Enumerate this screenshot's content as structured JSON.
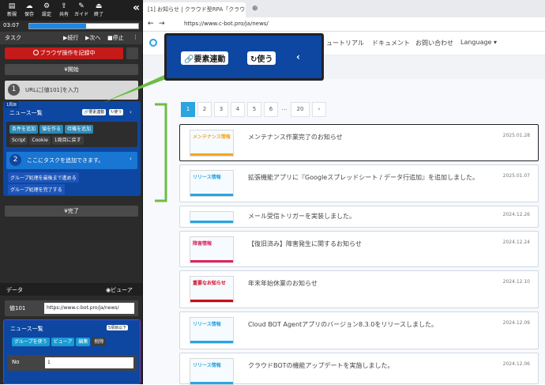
{
  "panel": {
    "toolbar": [
      {
        "label": "新規",
        "icon": "new-file-icon"
      },
      {
        "label": "保存",
        "icon": "cloud-save-icon"
      },
      {
        "label": "設定",
        "icon": "gear-icon"
      },
      {
        "label": "共有",
        "icon": "share-icon"
      },
      {
        "label": "ガイド",
        "icon": "guide-icon"
      },
      {
        "label": "終了",
        "icon": "exit-icon"
      }
    ],
    "collapse": "«",
    "timer": "03:07",
    "progress": 0.52,
    "task_label": "タスク",
    "continue": "▶続行",
    "next": "▶次へ",
    "stop": "■停止",
    "more": "⋮",
    "recording": "ブラウザ操作を記録中",
    "start": "¥開始",
    "step1_num": "1",
    "step1_text": "URLに[値101]を入力",
    "loop_tag": "1周目",
    "news_list": "ニュース一覧",
    "elem_link": "要素連動",
    "use": "使う",
    "btn_cond": "条件を追加",
    "btn_value": "値を作る",
    "btn_wait": "待機を追加",
    "btn_script": "Script",
    "btn_cookie": "Cookie",
    "btn_back": "1周目に戻す",
    "step2_num": "2",
    "step2_text": "ここにタスクを追加できます。",
    "group_next": "グループ処理を最後まで進める",
    "group_done": "グループ処理を完了する",
    "complete": "¥完了",
    "data_label": "データ",
    "viewer": "ビューア",
    "value101_label": "値101",
    "value101": "https://www.c-bot.pro/ja/news/",
    "news_list2": "ニュース一覧",
    "count_badge": "5項目以下",
    "use_group": "グループを使う",
    "viewer2": "ビューア",
    "edit": "編集",
    "delete": "削除",
    "no_label": "No",
    "no_value": "1"
  },
  "browser": {
    "tab_title": "[1] お知らせ | クラウド型RPA「クラウド",
    "url": "https://www.c-bot.pro/ja/news/",
    "nav": [
      "ュートリアル",
      "ドキュメント",
      "お問い合わせ",
      "Language ▾"
    ],
    "zoom_elem_link": "要素連動",
    "zoom_use": "使う",
    "pages": [
      "1",
      "2",
      "3",
      "4",
      "5",
      "6",
      "…",
      "20",
      "›"
    ],
    "news": [
      {
        "title": "メンテナンス作業完了のお知らせ",
        "date": "2025.01.28",
        "thumb": "メンテナンス情報",
        "thumb_color": "#f5a623"
      },
      {
        "title": "拡張機能アプリに『Googleスプレッドシート / データ行追加』を追加しました。",
        "date": "2025.01.07",
        "thumb": "リリース情報",
        "thumb_color": "#2ba4e0"
      },
      {
        "title": "メール受信トリガーを実装しました。",
        "date": "2024.12.26",
        "thumb": "",
        "thumb_color": "#2ba4e0"
      },
      {
        "title": "【復旧済み】障害発生に関するお知らせ",
        "date": "2024.12.24",
        "thumb": "障害情報",
        "thumb_color": "#e0245e"
      },
      {
        "title": "年末年始休業のお知らせ",
        "date": "2024.12.10",
        "thumb": "重要なお知らせ",
        "thumb_color": "#d0021b"
      },
      {
        "title": "Cloud BOT Agentアプリのバージョン8.3.0をリリースしました。",
        "date": "2024.12.09",
        "thumb": "リリース情報",
        "thumb_color": "#2ba4e0"
      },
      {
        "title": "クラウドBOTの機能アップデートを実施しました。",
        "date": "2024.12.06",
        "thumb": "リリース情報",
        "thumb_color": "#2ba4e0"
      }
    ]
  }
}
